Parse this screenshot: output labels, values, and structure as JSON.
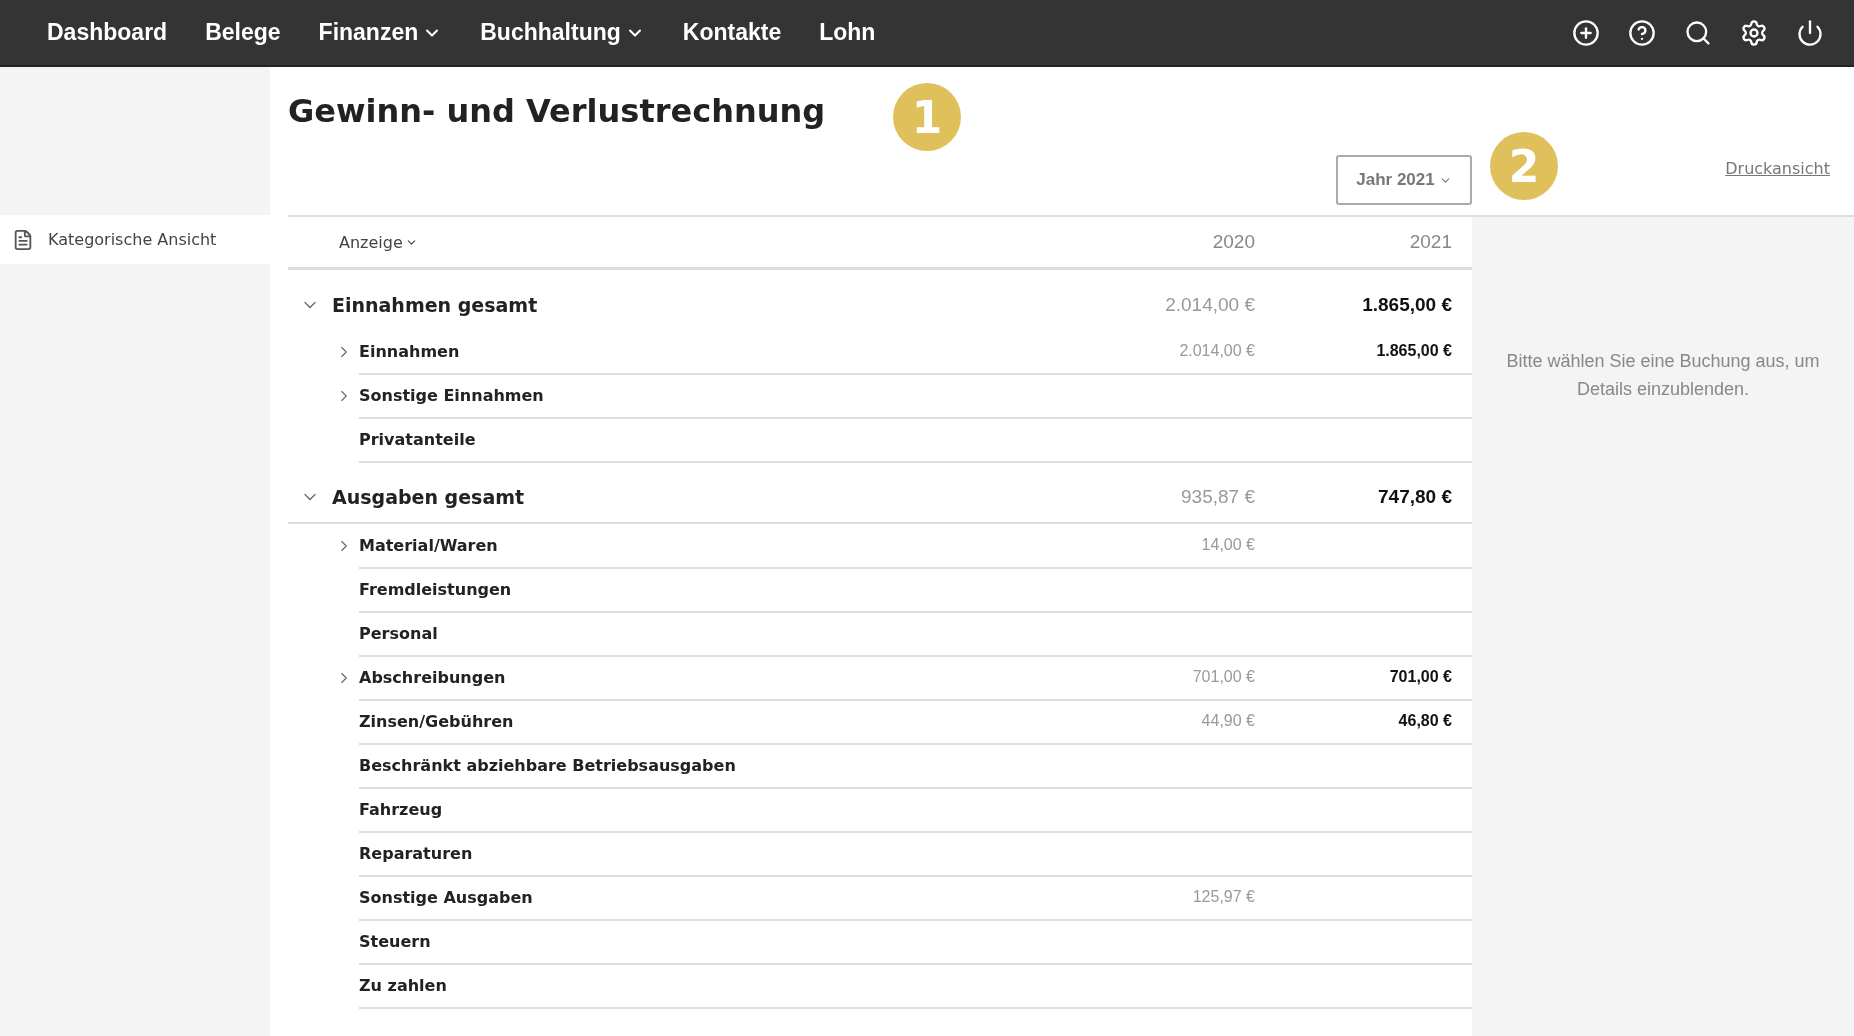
{
  "nav": {
    "items": [
      {
        "label": "Dashboard",
        "dropdown": false
      },
      {
        "label": "Belege",
        "dropdown": false
      },
      {
        "label": "Finanzen",
        "dropdown": true
      },
      {
        "label": "Buchhaltung",
        "dropdown": true
      },
      {
        "label": "Kontakte",
        "dropdown": false
      },
      {
        "label": "Lohn",
        "dropdown": false
      }
    ]
  },
  "sidebar": {
    "items": [
      {
        "label": "Kategorische Ansicht",
        "selected": true
      }
    ]
  },
  "title": "Gewinn- und Verlustrechnung",
  "badges": [
    "1",
    "2"
  ],
  "year_select": {
    "value": "Jahr 2021"
  },
  "print_link": "Druckansicht",
  "table": {
    "display_menu": "Anzeige",
    "columns": [
      "2020",
      "2021"
    ],
    "groups": [
      {
        "label": "Einnahmen gesamt",
        "expanded": true,
        "value_2020": "2.014,00 €",
        "value_2021": "1.865,00 €",
        "children": [
          {
            "label": "Einnahmen",
            "kind": "collapsible",
            "value_2020": "2.014,00 €",
            "value_2021": "1.865,00 €"
          },
          {
            "label": "Sonstige Einnahmen",
            "kind": "collapsible"
          },
          {
            "label": "Privatanteile",
            "kind": "leaf"
          }
        ]
      },
      {
        "label": "Ausgaben gesamt",
        "expanded": true,
        "value_2020": "935,87 €",
        "value_2021": "747,80 €",
        "children": [
          {
            "label": "Material/Waren",
            "kind": "collapsible",
            "value_2020": "14,00 €"
          },
          {
            "label": "Fremdleistungen",
            "kind": "leaf"
          },
          {
            "label": "Personal",
            "kind": "leaf"
          },
          {
            "label": "Abschreibungen",
            "kind": "collapsible",
            "value_2020": "701,00 €",
            "value_2021": "701,00 €"
          },
          {
            "label": "Zinsen/Gebühren",
            "kind": "leaf",
            "value_2020": "44,90 €",
            "value_2021": "46,80 €"
          },
          {
            "label": "Beschränkt abziehbare Betriebsausgaben",
            "kind": "leaf"
          },
          {
            "label": "Fahrzeug",
            "kind": "leaf"
          },
          {
            "label": "Reparaturen",
            "kind": "leaf"
          },
          {
            "label": "Sonstige Ausgaben",
            "kind": "leaf",
            "value_2020": "125,97 €"
          },
          {
            "label": "Steuern",
            "kind": "leaf"
          },
          {
            "label": "Zu zahlen",
            "kind": "leaf"
          }
        ]
      }
    ]
  },
  "detail_hint": "Bitte wählen Sie eine Buchung aus, um Details einzublenden."
}
